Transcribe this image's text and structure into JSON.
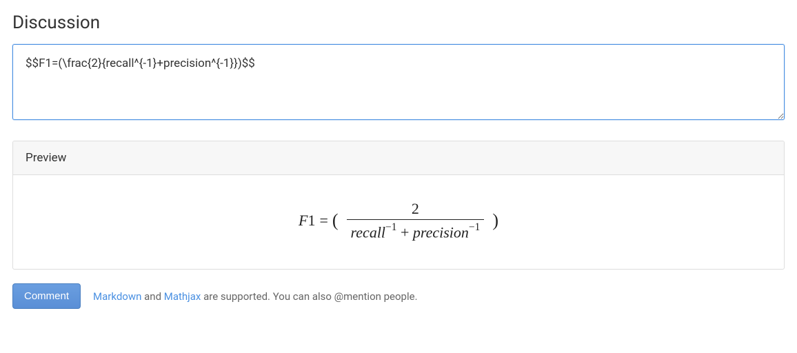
{
  "heading": "Discussion",
  "input": {
    "value": "$$F1=(\\frac{2}{recall^{-1}+precision^{-1}})$$"
  },
  "preview": {
    "label": "Preview",
    "math": {
      "lhs_var": "F",
      "lhs_num": "1",
      "eq": " = ",
      "lparen": "(",
      "rparen": ")",
      "numerator": "2",
      "den_recall": "recall",
      "den_exp1": "−1",
      "den_plus": " + ",
      "den_precision": "precision",
      "den_exp2": "−1"
    }
  },
  "footer": {
    "comment_button": "Comment",
    "hint_markdown": "Markdown",
    "hint_and": " and ",
    "hint_mathjax": "Mathjax",
    "hint_rest": " are supported. You can also @mention people."
  }
}
